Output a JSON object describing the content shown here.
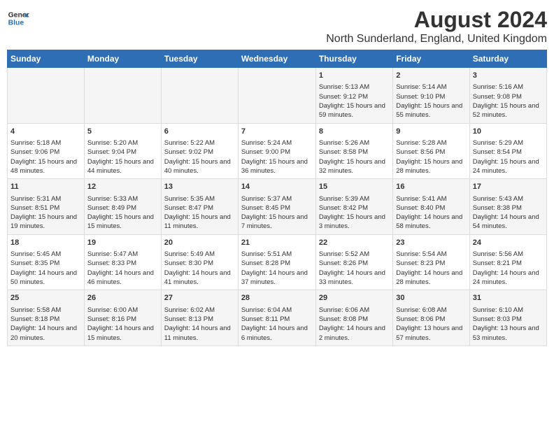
{
  "header": {
    "logo_line1": "General",
    "logo_line2": "Blue",
    "title": "August 2024",
    "subtitle": "North Sunderland, England, United Kingdom"
  },
  "weekdays": [
    "Sunday",
    "Monday",
    "Tuesday",
    "Wednesday",
    "Thursday",
    "Friday",
    "Saturday"
  ],
  "weeks": [
    [
      {
        "day": "",
        "text": ""
      },
      {
        "day": "",
        "text": ""
      },
      {
        "day": "",
        "text": ""
      },
      {
        "day": "",
        "text": ""
      },
      {
        "day": "1",
        "text": "Sunrise: 5:13 AM\nSunset: 9:12 PM\nDaylight: 15 hours and 59 minutes."
      },
      {
        "day": "2",
        "text": "Sunrise: 5:14 AM\nSunset: 9:10 PM\nDaylight: 15 hours and 55 minutes."
      },
      {
        "day": "3",
        "text": "Sunrise: 5:16 AM\nSunset: 9:08 PM\nDaylight: 15 hours and 52 minutes."
      }
    ],
    [
      {
        "day": "4",
        "text": "Sunrise: 5:18 AM\nSunset: 9:06 PM\nDaylight: 15 hours and 48 minutes."
      },
      {
        "day": "5",
        "text": "Sunrise: 5:20 AM\nSunset: 9:04 PM\nDaylight: 15 hours and 44 minutes."
      },
      {
        "day": "6",
        "text": "Sunrise: 5:22 AM\nSunset: 9:02 PM\nDaylight: 15 hours and 40 minutes."
      },
      {
        "day": "7",
        "text": "Sunrise: 5:24 AM\nSunset: 9:00 PM\nDaylight: 15 hours and 36 minutes."
      },
      {
        "day": "8",
        "text": "Sunrise: 5:26 AM\nSunset: 8:58 PM\nDaylight: 15 hours and 32 minutes."
      },
      {
        "day": "9",
        "text": "Sunrise: 5:28 AM\nSunset: 8:56 PM\nDaylight: 15 hours and 28 minutes."
      },
      {
        "day": "10",
        "text": "Sunrise: 5:29 AM\nSunset: 8:54 PM\nDaylight: 15 hours and 24 minutes."
      }
    ],
    [
      {
        "day": "11",
        "text": "Sunrise: 5:31 AM\nSunset: 8:51 PM\nDaylight: 15 hours and 19 minutes."
      },
      {
        "day": "12",
        "text": "Sunrise: 5:33 AM\nSunset: 8:49 PM\nDaylight: 15 hours and 15 minutes."
      },
      {
        "day": "13",
        "text": "Sunrise: 5:35 AM\nSunset: 8:47 PM\nDaylight: 15 hours and 11 minutes."
      },
      {
        "day": "14",
        "text": "Sunrise: 5:37 AM\nSunset: 8:45 PM\nDaylight: 15 hours and 7 minutes."
      },
      {
        "day": "15",
        "text": "Sunrise: 5:39 AM\nSunset: 8:42 PM\nDaylight: 15 hours and 3 minutes."
      },
      {
        "day": "16",
        "text": "Sunrise: 5:41 AM\nSunset: 8:40 PM\nDaylight: 14 hours and 58 minutes."
      },
      {
        "day": "17",
        "text": "Sunrise: 5:43 AM\nSunset: 8:38 PM\nDaylight: 14 hours and 54 minutes."
      }
    ],
    [
      {
        "day": "18",
        "text": "Sunrise: 5:45 AM\nSunset: 8:35 PM\nDaylight: 14 hours and 50 minutes."
      },
      {
        "day": "19",
        "text": "Sunrise: 5:47 AM\nSunset: 8:33 PM\nDaylight: 14 hours and 46 minutes."
      },
      {
        "day": "20",
        "text": "Sunrise: 5:49 AM\nSunset: 8:30 PM\nDaylight: 14 hours and 41 minutes."
      },
      {
        "day": "21",
        "text": "Sunrise: 5:51 AM\nSunset: 8:28 PM\nDaylight: 14 hours and 37 minutes."
      },
      {
        "day": "22",
        "text": "Sunrise: 5:52 AM\nSunset: 8:26 PM\nDaylight: 14 hours and 33 minutes."
      },
      {
        "day": "23",
        "text": "Sunrise: 5:54 AM\nSunset: 8:23 PM\nDaylight: 14 hours and 28 minutes."
      },
      {
        "day": "24",
        "text": "Sunrise: 5:56 AM\nSunset: 8:21 PM\nDaylight: 14 hours and 24 minutes."
      }
    ],
    [
      {
        "day": "25",
        "text": "Sunrise: 5:58 AM\nSunset: 8:18 PM\nDaylight: 14 hours and 20 minutes."
      },
      {
        "day": "26",
        "text": "Sunrise: 6:00 AM\nSunset: 8:16 PM\nDaylight: 14 hours and 15 minutes."
      },
      {
        "day": "27",
        "text": "Sunrise: 6:02 AM\nSunset: 8:13 PM\nDaylight: 14 hours and 11 minutes."
      },
      {
        "day": "28",
        "text": "Sunrise: 6:04 AM\nSunset: 8:11 PM\nDaylight: 14 hours and 6 minutes."
      },
      {
        "day": "29",
        "text": "Sunrise: 6:06 AM\nSunset: 8:08 PM\nDaylight: 14 hours and 2 minutes."
      },
      {
        "day": "30",
        "text": "Sunrise: 6:08 AM\nSunset: 8:06 PM\nDaylight: 13 hours and 57 minutes."
      },
      {
        "day": "31",
        "text": "Sunrise: 6:10 AM\nSunset: 8:03 PM\nDaylight: 13 hours and 53 minutes."
      }
    ]
  ]
}
